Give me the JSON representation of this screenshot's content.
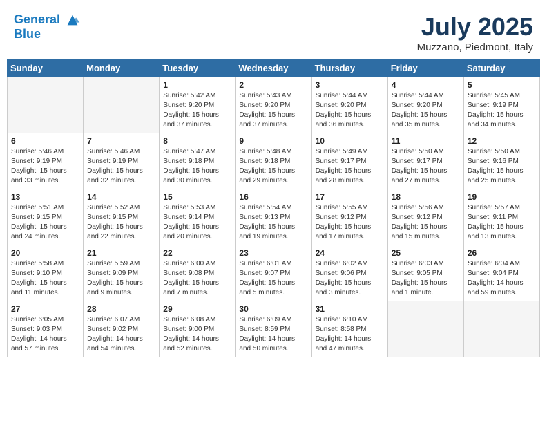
{
  "header": {
    "logo_line1": "General",
    "logo_line2": "Blue",
    "month_year": "July 2025",
    "location": "Muzzano, Piedmont, Italy"
  },
  "weekdays": [
    "Sunday",
    "Monday",
    "Tuesday",
    "Wednesday",
    "Thursday",
    "Friday",
    "Saturday"
  ],
  "weeks": [
    [
      {
        "day": "",
        "content": ""
      },
      {
        "day": "",
        "content": ""
      },
      {
        "day": "1",
        "content": "Sunrise: 5:42 AM\nSunset: 9:20 PM\nDaylight: 15 hours\nand 37 minutes."
      },
      {
        "day": "2",
        "content": "Sunrise: 5:43 AM\nSunset: 9:20 PM\nDaylight: 15 hours\nand 37 minutes."
      },
      {
        "day": "3",
        "content": "Sunrise: 5:44 AM\nSunset: 9:20 PM\nDaylight: 15 hours\nand 36 minutes."
      },
      {
        "day": "4",
        "content": "Sunrise: 5:44 AM\nSunset: 9:20 PM\nDaylight: 15 hours\nand 35 minutes."
      },
      {
        "day": "5",
        "content": "Sunrise: 5:45 AM\nSunset: 9:19 PM\nDaylight: 15 hours\nand 34 minutes."
      }
    ],
    [
      {
        "day": "6",
        "content": "Sunrise: 5:46 AM\nSunset: 9:19 PM\nDaylight: 15 hours\nand 33 minutes."
      },
      {
        "day": "7",
        "content": "Sunrise: 5:46 AM\nSunset: 9:19 PM\nDaylight: 15 hours\nand 32 minutes."
      },
      {
        "day": "8",
        "content": "Sunrise: 5:47 AM\nSunset: 9:18 PM\nDaylight: 15 hours\nand 30 minutes."
      },
      {
        "day": "9",
        "content": "Sunrise: 5:48 AM\nSunset: 9:18 PM\nDaylight: 15 hours\nand 29 minutes."
      },
      {
        "day": "10",
        "content": "Sunrise: 5:49 AM\nSunset: 9:17 PM\nDaylight: 15 hours\nand 28 minutes."
      },
      {
        "day": "11",
        "content": "Sunrise: 5:50 AM\nSunset: 9:17 PM\nDaylight: 15 hours\nand 27 minutes."
      },
      {
        "day": "12",
        "content": "Sunrise: 5:50 AM\nSunset: 9:16 PM\nDaylight: 15 hours\nand 25 minutes."
      }
    ],
    [
      {
        "day": "13",
        "content": "Sunrise: 5:51 AM\nSunset: 9:15 PM\nDaylight: 15 hours\nand 24 minutes."
      },
      {
        "day": "14",
        "content": "Sunrise: 5:52 AM\nSunset: 9:15 PM\nDaylight: 15 hours\nand 22 minutes."
      },
      {
        "day": "15",
        "content": "Sunrise: 5:53 AM\nSunset: 9:14 PM\nDaylight: 15 hours\nand 20 minutes."
      },
      {
        "day": "16",
        "content": "Sunrise: 5:54 AM\nSunset: 9:13 PM\nDaylight: 15 hours\nand 19 minutes."
      },
      {
        "day": "17",
        "content": "Sunrise: 5:55 AM\nSunset: 9:12 PM\nDaylight: 15 hours\nand 17 minutes."
      },
      {
        "day": "18",
        "content": "Sunrise: 5:56 AM\nSunset: 9:12 PM\nDaylight: 15 hours\nand 15 minutes."
      },
      {
        "day": "19",
        "content": "Sunrise: 5:57 AM\nSunset: 9:11 PM\nDaylight: 15 hours\nand 13 minutes."
      }
    ],
    [
      {
        "day": "20",
        "content": "Sunrise: 5:58 AM\nSunset: 9:10 PM\nDaylight: 15 hours\nand 11 minutes."
      },
      {
        "day": "21",
        "content": "Sunrise: 5:59 AM\nSunset: 9:09 PM\nDaylight: 15 hours\nand 9 minutes."
      },
      {
        "day": "22",
        "content": "Sunrise: 6:00 AM\nSunset: 9:08 PM\nDaylight: 15 hours\nand 7 minutes."
      },
      {
        "day": "23",
        "content": "Sunrise: 6:01 AM\nSunset: 9:07 PM\nDaylight: 15 hours\nand 5 minutes."
      },
      {
        "day": "24",
        "content": "Sunrise: 6:02 AM\nSunset: 9:06 PM\nDaylight: 15 hours\nand 3 minutes."
      },
      {
        "day": "25",
        "content": "Sunrise: 6:03 AM\nSunset: 9:05 PM\nDaylight: 15 hours\nand 1 minute."
      },
      {
        "day": "26",
        "content": "Sunrise: 6:04 AM\nSunset: 9:04 PM\nDaylight: 14 hours\nand 59 minutes."
      }
    ],
    [
      {
        "day": "27",
        "content": "Sunrise: 6:05 AM\nSunset: 9:03 PM\nDaylight: 14 hours\nand 57 minutes."
      },
      {
        "day": "28",
        "content": "Sunrise: 6:07 AM\nSunset: 9:02 PM\nDaylight: 14 hours\nand 54 minutes."
      },
      {
        "day": "29",
        "content": "Sunrise: 6:08 AM\nSunset: 9:00 PM\nDaylight: 14 hours\nand 52 minutes."
      },
      {
        "day": "30",
        "content": "Sunrise: 6:09 AM\nSunset: 8:59 PM\nDaylight: 14 hours\nand 50 minutes."
      },
      {
        "day": "31",
        "content": "Sunrise: 6:10 AM\nSunset: 8:58 PM\nDaylight: 14 hours\nand 47 minutes."
      },
      {
        "day": "",
        "content": ""
      },
      {
        "day": "",
        "content": ""
      }
    ]
  ]
}
